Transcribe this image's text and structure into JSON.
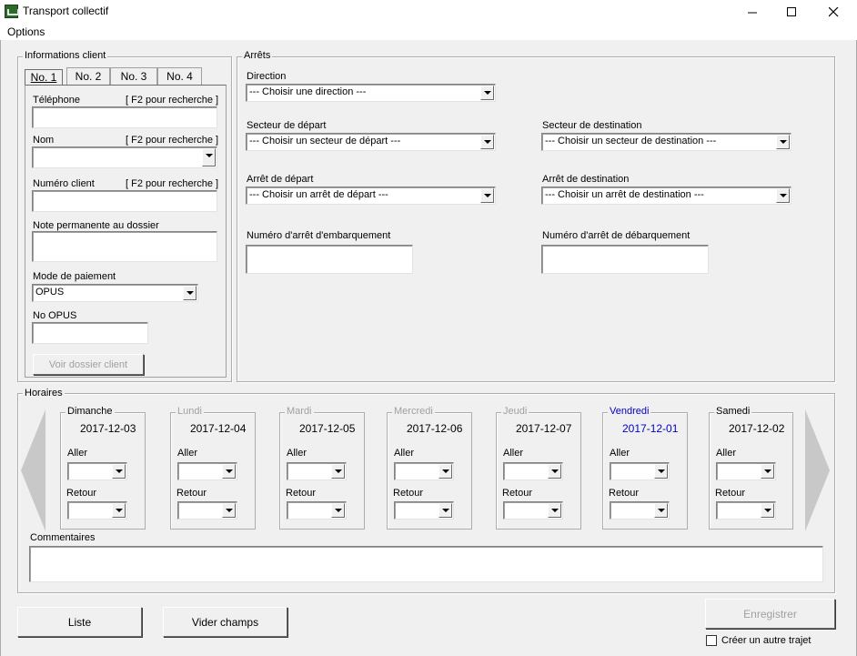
{
  "window": {
    "title": "Transport collectif"
  },
  "menu": {
    "options": "Options"
  },
  "client_info": {
    "group_label": "Informations client",
    "tabs": [
      "No. 1",
      "No. 2",
      "No. 3",
      "No. 4"
    ],
    "telephone_label": "Téléphone",
    "f2_hint": "[ F2 pour recherche ]",
    "nom_label": "Nom",
    "numero_client_label": "Numéro client",
    "note_label": "Note permanente au dossier",
    "mode_paiement_label": "Mode de paiement",
    "mode_paiement_value": "OPUS",
    "no_opus_label": "No OPUS",
    "voir_dossier_button": "Voir dossier client"
  },
  "arrets": {
    "group_label": "Arrêts",
    "direction_label": "Direction",
    "direction_value": "--- Choisir une direction ---",
    "secteur_depart_label": "Secteur de départ",
    "secteur_depart_value": "--- Choisir un secteur de départ ---",
    "secteur_destination_label": "Secteur de destination",
    "secteur_destination_value": "--- Choisir un secteur de destination ---",
    "arret_depart_label": "Arrêt de départ",
    "arret_depart_value": "--- Choisir un arrêt de départ ---",
    "arret_destination_label": "Arrêt de destination",
    "arret_destination_value": "--- Choisir un arrêt de destination ---",
    "num_embarquement_label": "Numéro d'arrêt d'embarquement",
    "num_debarquement_label": "Numéro d'arrêt de débarquement"
  },
  "horaires": {
    "group_label": "Horaires",
    "aller_label": "Aller",
    "retour_label": "Retour",
    "days": [
      {
        "name": "Dimanche",
        "date": "2017-12-03",
        "state": "normal"
      },
      {
        "name": "Lundi",
        "date": "2017-12-04",
        "state": "disabled"
      },
      {
        "name": "Mardi",
        "date": "2017-12-05",
        "state": "disabled"
      },
      {
        "name": "Mercredi",
        "date": "2017-12-06",
        "state": "disabled"
      },
      {
        "name": "Jeudi",
        "date": "2017-12-07",
        "state": "disabled"
      },
      {
        "name": "Vendredi",
        "date": "2017-12-01",
        "state": "highlight"
      },
      {
        "name": "Samedi",
        "date": "2017-12-02",
        "state": "normal"
      }
    ],
    "commentaires_label": "Commentaires"
  },
  "footer": {
    "liste_button": "Liste",
    "vider_button": "Vider champs",
    "enregistrer_button": "Enregistrer",
    "autre_trajet_label": "Créer un autre trajet"
  },
  "colors": {
    "highlight_blue": "#0000cc",
    "disabled_gray": "#a0a0a0",
    "window_bg": "#f0f0f0"
  },
  "icons": {
    "minimize": "minimize-icon",
    "maximize": "maximize-icon",
    "close": "close-icon",
    "prev": "arrow-left-icon",
    "next": "arrow-right-icon"
  }
}
